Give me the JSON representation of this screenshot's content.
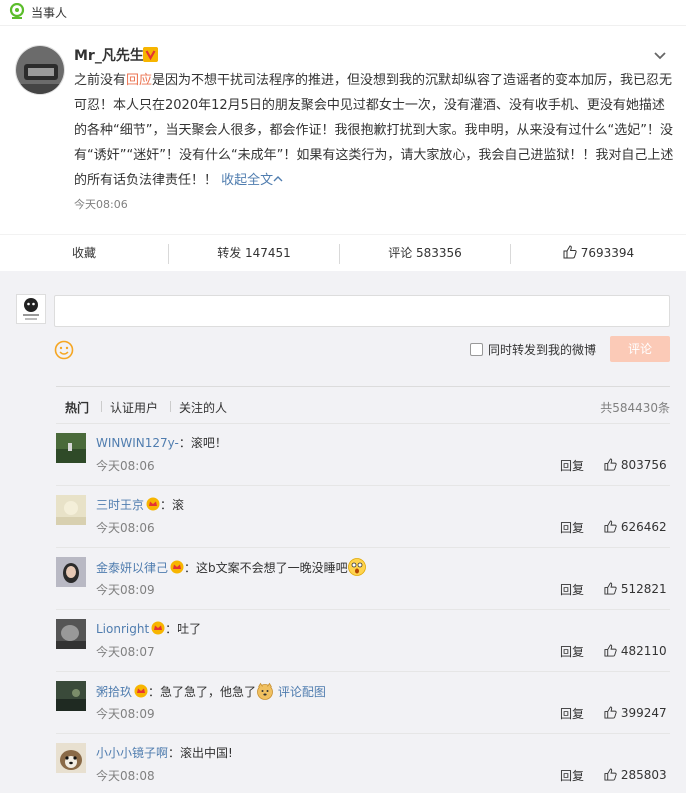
{
  "tag": {
    "label": "当事人"
  },
  "post": {
    "author": "Mr_凡先生",
    "text_part1": "之前没有",
    "text_highlight": "回应",
    "text_part2": "是因为不想干扰司法程序的推进，但没想到我的沉默却纵容了造谣者的变本加厉，我已忍无可忍！本人只在2020年12月5日的朋友聚会中见过都女士一次，没有灌酒、没有收手机、更没有她描述的各种“细节”，当天聚会人很多，都会作证！我很抱歉打扰到大家。我申明，从来没有过什么“选妃”！没有“诱奸”“迷奸”！没有什么“未成年”！如果有这类行为，请大家放心，我会自己进监狱！！我对自己上述的所有话负法律责任！！",
    "collapse_link": "收起全文",
    "time": "今天08:06"
  },
  "actions": {
    "favorite": "收藏",
    "repost": "转发 147451",
    "comment": "评论 583356",
    "like": "7693394"
  },
  "composer": {
    "repost_label": "同时转发到我的微博",
    "submit": "评论"
  },
  "tabs": {
    "hot": "热门",
    "verified": "认证用户",
    "following": "关注的人",
    "total": "共584430条"
  },
  "comments": [
    {
      "user": "WINWIN127y-",
      "text": "：滚吧！",
      "time": "今天08:06",
      "reply": "回复",
      "likes": "803756",
      "crown": false
    },
    {
      "user": "三时王京",
      "text": "：滚",
      "time": "今天08:06",
      "reply": "回复",
      "likes": "626462",
      "crown": true
    },
    {
      "user": "金泰妍以律己",
      "text": "：这b文案不会想了一晚没睡吧",
      "time": "今天08:09",
      "reply": "回复",
      "likes": "512821",
      "crown": true
    },
    {
      "user": "Lionright",
      "text": "：吐了",
      "time": "今天08:07",
      "reply": "回复",
      "likes": "482110",
      "crown": true
    },
    {
      "user": "粥拾玖",
      "text": "：急了急了，他急了",
      "link": "评论配图",
      "time": "今天08:09",
      "reply": "回复",
      "likes": "399247",
      "crown": true
    },
    {
      "user": "小小小镜子啊",
      "text": "：滚出中国!",
      "time": "今天08:08",
      "reply": "回复",
      "likes": "285803",
      "crown": false
    }
  ],
  "colors": {
    "link_blue": "#507daf",
    "orange": "#eb7350",
    "button_orange": "#fbcab7",
    "bg_gray": "#f2f2f5"
  }
}
